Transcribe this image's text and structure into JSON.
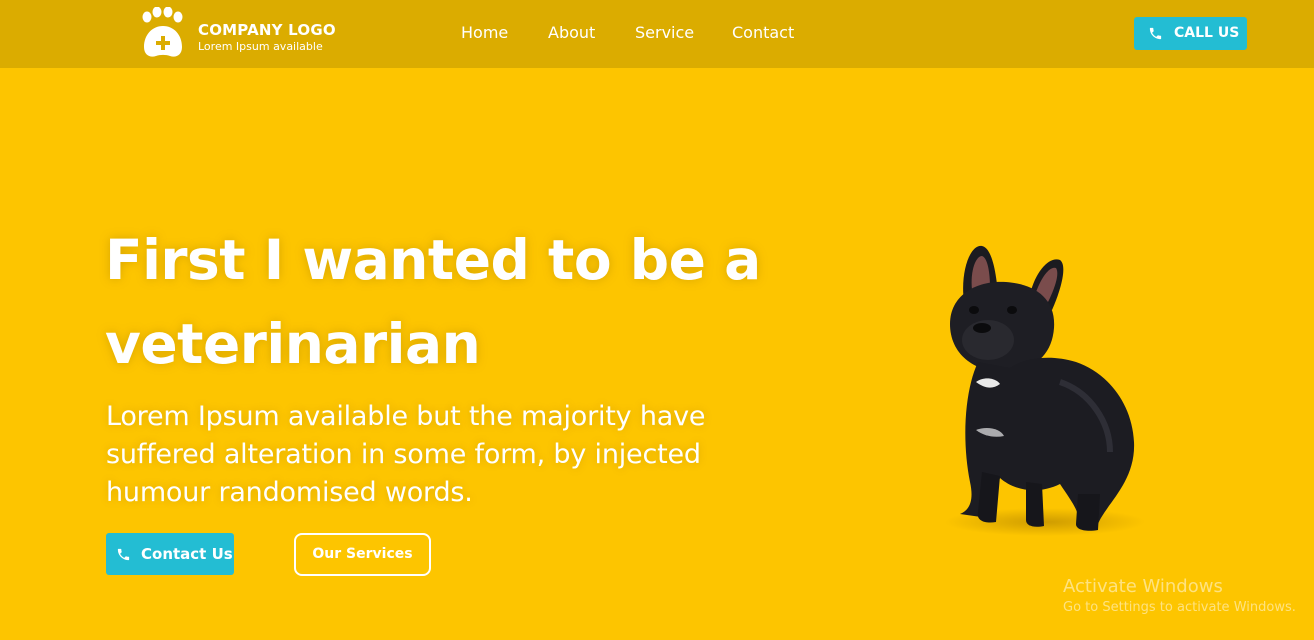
{
  "header": {
    "logo_title": "COMPANY LOGO",
    "logo_subtitle": "Lorem Ipsum available",
    "logo_icon": "paw-plus-icon",
    "nav": [
      {
        "label": "Home"
      },
      {
        "label": "About"
      },
      {
        "label": "Service"
      },
      {
        "label": "Contact"
      }
    ],
    "call_button": {
      "label": "CALL US",
      "icon": "phone-icon"
    }
  },
  "hero": {
    "headline_line1": "First I wanted to be a",
    "headline_line2": "veterinarian",
    "description_line1": "Lorem Ipsum available but the majority have",
    "description_line2": "suffered alteration in some form, by injected",
    "description_line3": "humour randomised words.",
    "contact_button": {
      "label": "Contact Us",
      "icon": "phone-icon"
    },
    "services_button": {
      "label": "Our Services"
    },
    "image": "french-bulldog-image"
  },
  "watermark": {
    "title": "Activate Windows",
    "subtitle": "Go to Settings to activate Windows."
  },
  "colors": {
    "background": "#fdc500",
    "header": "#dbac00",
    "accent": "#23bdd3",
    "text": "#ffffff"
  }
}
